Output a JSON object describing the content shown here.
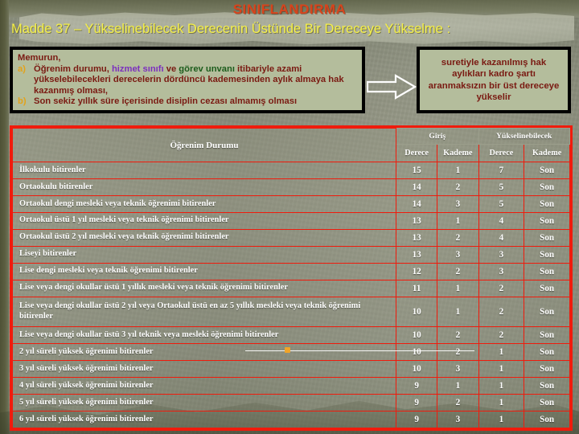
{
  "slide": {
    "title": "SINIFLANDIRMA",
    "subtitle": "Madde 37 – Yükselinebilecek Derecenin Üstünde Bir Dereceye Yükselme :",
    "title_color": "#d8441c",
    "subtitle_color": "#f5f049"
  },
  "rule_box": {
    "lead": "Memurun,",
    "items": [
      {
        "marker": "a)",
        "segments": [
          {
            "text": "Öğrenim durumu, ",
            "color": "#7a1a12"
          },
          {
            "text": "hizmet sınıfı",
            "color": "#7b2fbe"
          },
          {
            "text": " ve ",
            "color": "#7a1a12"
          },
          {
            "text": "görev unvanı",
            "color": "#1c5c1c"
          },
          {
            "text": " itibariyle azami yükselebilecekleri derecelerin dördüncü kademesinden aylık almaya hak kazanmış olması,",
            "color": "#7a1a12"
          }
        ]
      },
      {
        "marker": "b)",
        "segments": [
          {
            "text": "Son sekiz yıllık süre içerisinde disiplin cezası almamış olması",
            "color": "#7a1a12"
          }
        ]
      }
    ]
  },
  "arrow": {
    "name": "right-arrow",
    "direction": "right",
    "color": "#ffffff"
  },
  "result_box": {
    "text": "suretiyle kazanılmış hak aylıkları kadro şartı aranmaksızın bir üst dereceye yükselir"
  },
  "table": {
    "accent_color": "#f01b0c",
    "first_col_header": "Öğrenim Durumu",
    "group_headers": [
      {
        "label": "Giriş",
        "span": 2
      },
      {
        "label": "Yükselinebilecek",
        "span": 2
      }
    ],
    "sub_headers": [
      "Derece",
      "Kademe",
      "Derece",
      "Kademe"
    ],
    "rows": [
      {
        "name": "İlkokulu bitirenler",
        "giris_derece": "15",
        "giris_kademe": "1",
        "yuk_derece": "7",
        "yuk_kademe": "Son"
      },
      {
        "name": "Ortaokulu bitirenler",
        "giris_derece": "14",
        "giris_kademe": "2",
        "yuk_derece": "5",
        "yuk_kademe": "Son"
      },
      {
        "name": "Ortaokul dengi mesleki veya teknik öğrenimi bitirenler",
        "giris_derece": "14",
        "giris_kademe": "3",
        "yuk_derece": "5",
        "yuk_kademe": "Son"
      },
      {
        "name": "Ortaokul üstü 1 yıl mesleki veya teknik öğrenimi bitirenler",
        "giris_derece": "13",
        "giris_kademe": "1",
        "yuk_derece": "4",
        "yuk_kademe": "Son"
      },
      {
        "name": "Ortaokul üstü 2 yıl mesleki veya teknik öğrenimi bitirenler",
        "giris_derece": "13",
        "giris_kademe": "2",
        "yuk_derece": "4",
        "yuk_kademe": "Son"
      },
      {
        "name": "Liseyi bitirenler",
        "giris_derece": "13",
        "giris_kademe": "3",
        "yuk_derece": "3",
        "yuk_kademe": "Son"
      },
      {
        "name": "Lise dengi mesleki veya teknik öğrenimi bitirenler",
        "giris_derece": "12",
        "giris_kademe": "2",
        "yuk_derece": "3",
        "yuk_kademe": "Son"
      },
      {
        "name": "Lise veya dengi okullar üstü 1 yıllık mesleki veya teknik öğrenimi bitirenler",
        "giris_derece": "11",
        "giris_kademe": "1",
        "yuk_derece": "2",
        "yuk_kademe": "Son"
      },
      {
        "name": "Lise veya dengi okullar üstü 2 yıl veya Ortaokul üstü en az 5 yıllık mesleki veya teknik öğrenimi bitirenler",
        "giris_derece": "10",
        "giris_kademe": "1",
        "yuk_derece": "2",
        "yuk_kademe": "Son"
      },
      {
        "name": "Lise veya dengi okullar üstü 3 yıl teknik veya mesleki öğrenimi bitirenler",
        "giris_derece": "10",
        "giris_kademe": "2",
        "yuk_derece": "2",
        "yuk_kademe": "Son"
      },
      {
        "name": "2 yıl süreli yüksek öğrenimi bitirenler",
        "giris_derece": "10",
        "giris_kademe": "2",
        "yuk_derece": "1",
        "yuk_kademe": "Son"
      },
      {
        "name": "3 yıl süreli yüksek öğrenimi bitirenler",
        "giris_derece": "10",
        "giris_kademe": "3",
        "yuk_derece": "1",
        "yuk_kademe": "Son"
      },
      {
        "name": "4 yıl süreli yüksek öğrenimi bitirenler",
        "giris_derece": "9",
        "giris_kademe": "1",
        "yuk_derece": "1",
        "yuk_kademe": "Son"
      },
      {
        "name": "5 yıl süreli yüksek öğrenimi bitirenler",
        "giris_derece": "9",
        "giris_kademe": "2",
        "yuk_derece": "1",
        "yuk_kademe": "Son"
      },
      {
        "name": "6 yıl süreli yüksek öğrenimi bitirenler",
        "giris_derece": "9",
        "giris_kademe": "3",
        "yuk_derece": "1",
        "yuk_kademe": "Son"
      }
    ]
  },
  "annotation": {
    "ink_line_row_index": 3,
    "ink_line_color": "#ffffff",
    "ink_dot_color": "#f0a428"
  }
}
